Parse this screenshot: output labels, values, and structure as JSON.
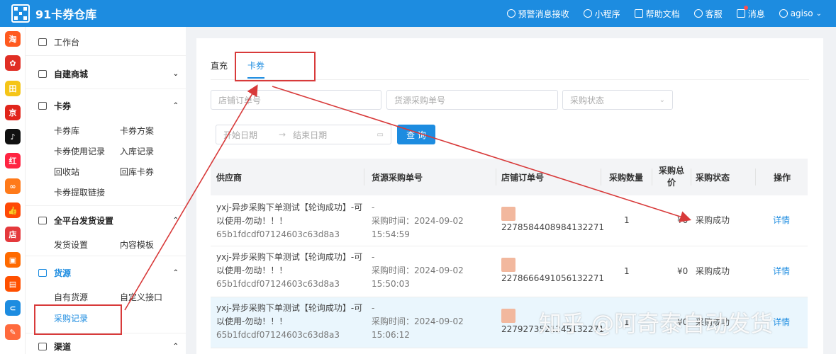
{
  "header": {
    "app_title": "91卡券仓库",
    "nav": [
      {
        "label": "预警消息接收",
        "icon": "bell-icon"
      },
      {
        "label": "小程序",
        "icon": "mini-program-icon"
      },
      {
        "label": "帮助文档",
        "icon": "doc-icon"
      },
      {
        "label": "客服",
        "icon": "headset-icon"
      },
      {
        "label": "消息",
        "icon": "mail-icon"
      },
      {
        "label": "agiso",
        "icon": "user-icon"
      }
    ]
  },
  "app_icons": [
    {
      "name": "taobao-app-icon",
      "glyph": "淘",
      "color": "#ff5a1f"
    },
    {
      "name": "pinduoduo-app-icon",
      "glyph": "✿",
      "color": "#e02e24"
    },
    {
      "name": "tianmao-app-icon",
      "glyph": "田",
      "color": "#f5c518"
    },
    {
      "name": "jingdong-app-icon",
      "glyph": "京",
      "color": "#e1251b"
    },
    {
      "name": "douyin-app-icon",
      "glyph": "♪",
      "color": "#111111"
    },
    {
      "name": "xiaohongshu-app-icon",
      "glyph": "红",
      "color": "#ff2442"
    },
    {
      "name": "dots-app-icon",
      "glyph": "∞",
      "color": "#ff7a1a"
    },
    {
      "name": "kuaishou-app-icon",
      "glyph": "👍",
      "color": "#ff4906"
    },
    {
      "name": "dian-app-icon",
      "glyph": "店",
      "color": "#e4393c"
    },
    {
      "name": "shop-app-icon",
      "glyph": "▣",
      "color": "#ff6a00"
    },
    {
      "name": "bag-app-icon",
      "glyph": "▤",
      "color": "#ff5000"
    },
    {
      "name": "link-app-icon",
      "glyph": "⊂",
      "color": "#1d8ce0"
    },
    {
      "name": "edit-app-icon",
      "glyph": "✎",
      "color": "#ff6a3d"
    }
  ],
  "sidebar": {
    "workbench": "工作台",
    "mall": "自建商城",
    "cards": {
      "label": "卡券",
      "items": [
        "卡券库",
        "卡券方案",
        "卡券使用记录",
        "入库记录",
        "回收站",
        "回库卡券",
        "卡券提取链接"
      ]
    },
    "shipping": {
      "label": "全平台发货设置",
      "items": [
        "发货设置",
        "内容模板"
      ]
    },
    "sourcing": {
      "label": "货源",
      "items": [
        "自有货源",
        "自定义接口",
        "采购记录"
      ]
    },
    "channels": "渠道"
  },
  "tabs": [
    "直充",
    "卡券"
  ],
  "filters": {
    "shop_order_placeholder": "店铺订单号",
    "purchase_no_placeholder": "货源采购单号",
    "status_placeholder": "采购状态",
    "start_date_placeholder": "开始日期",
    "end_date_placeholder": "结束日期",
    "search_label": "查 询"
  },
  "table": {
    "columns": [
      "供应商",
      "货源采购单号",
      "店铺订单号",
      "采购数量",
      "采购总价",
      "采购状态",
      "操作"
    ],
    "rows": [
      {
        "supplier": "yxj-异步采购下单测试【轮询成功】-可以使用-勿动！！！",
        "supplier_id": "65b1fdcdf07124603c63d8a3",
        "purchase_no": "-",
        "purchase_time": "采购时间：2024-09-02 15:54:59",
        "shop_order": "2278584408984132271",
        "qty": "1",
        "total": "¥0",
        "status": "采购成功",
        "action": "详情"
      },
      {
        "supplier": "yxj-异步采购下单测试【轮询成功】-可以使用-勿动！！！",
        "supplier_id": "65b1fdcdf07124603c63d8a3",
        "purchase_no": "-",
        "purchase_time": "采购时间：2024-09-02 15:50:03",
        "shop_order": "2278666491056132271",
        "qty": "1",
        "total": "¥0",
        "status": "采购成功",
        "action": "详情"
      },
      {
        "supplier": "yxj-异步采购下单测试【轮询成功】-可以使用-勿动！！！",
        "supplier_id": "65b1fdcdf07124603c63d8a3",
        "purchase_no": "-",
        "purchase_time": "采购时间：2024-09-02 15:06:12",
        "shop_order": "2279273521245132271",
        "qty": "1",
        "total": "¥0",
        "status": "采购成功",
        "action": "详情"
      }
    ]
  },
  "watermark": "知乎 @阿奇泰自动发货",
  "colors": {
    "primary": "#1d8ce0",
    "annotation": "#d83a3a"
  }
}
